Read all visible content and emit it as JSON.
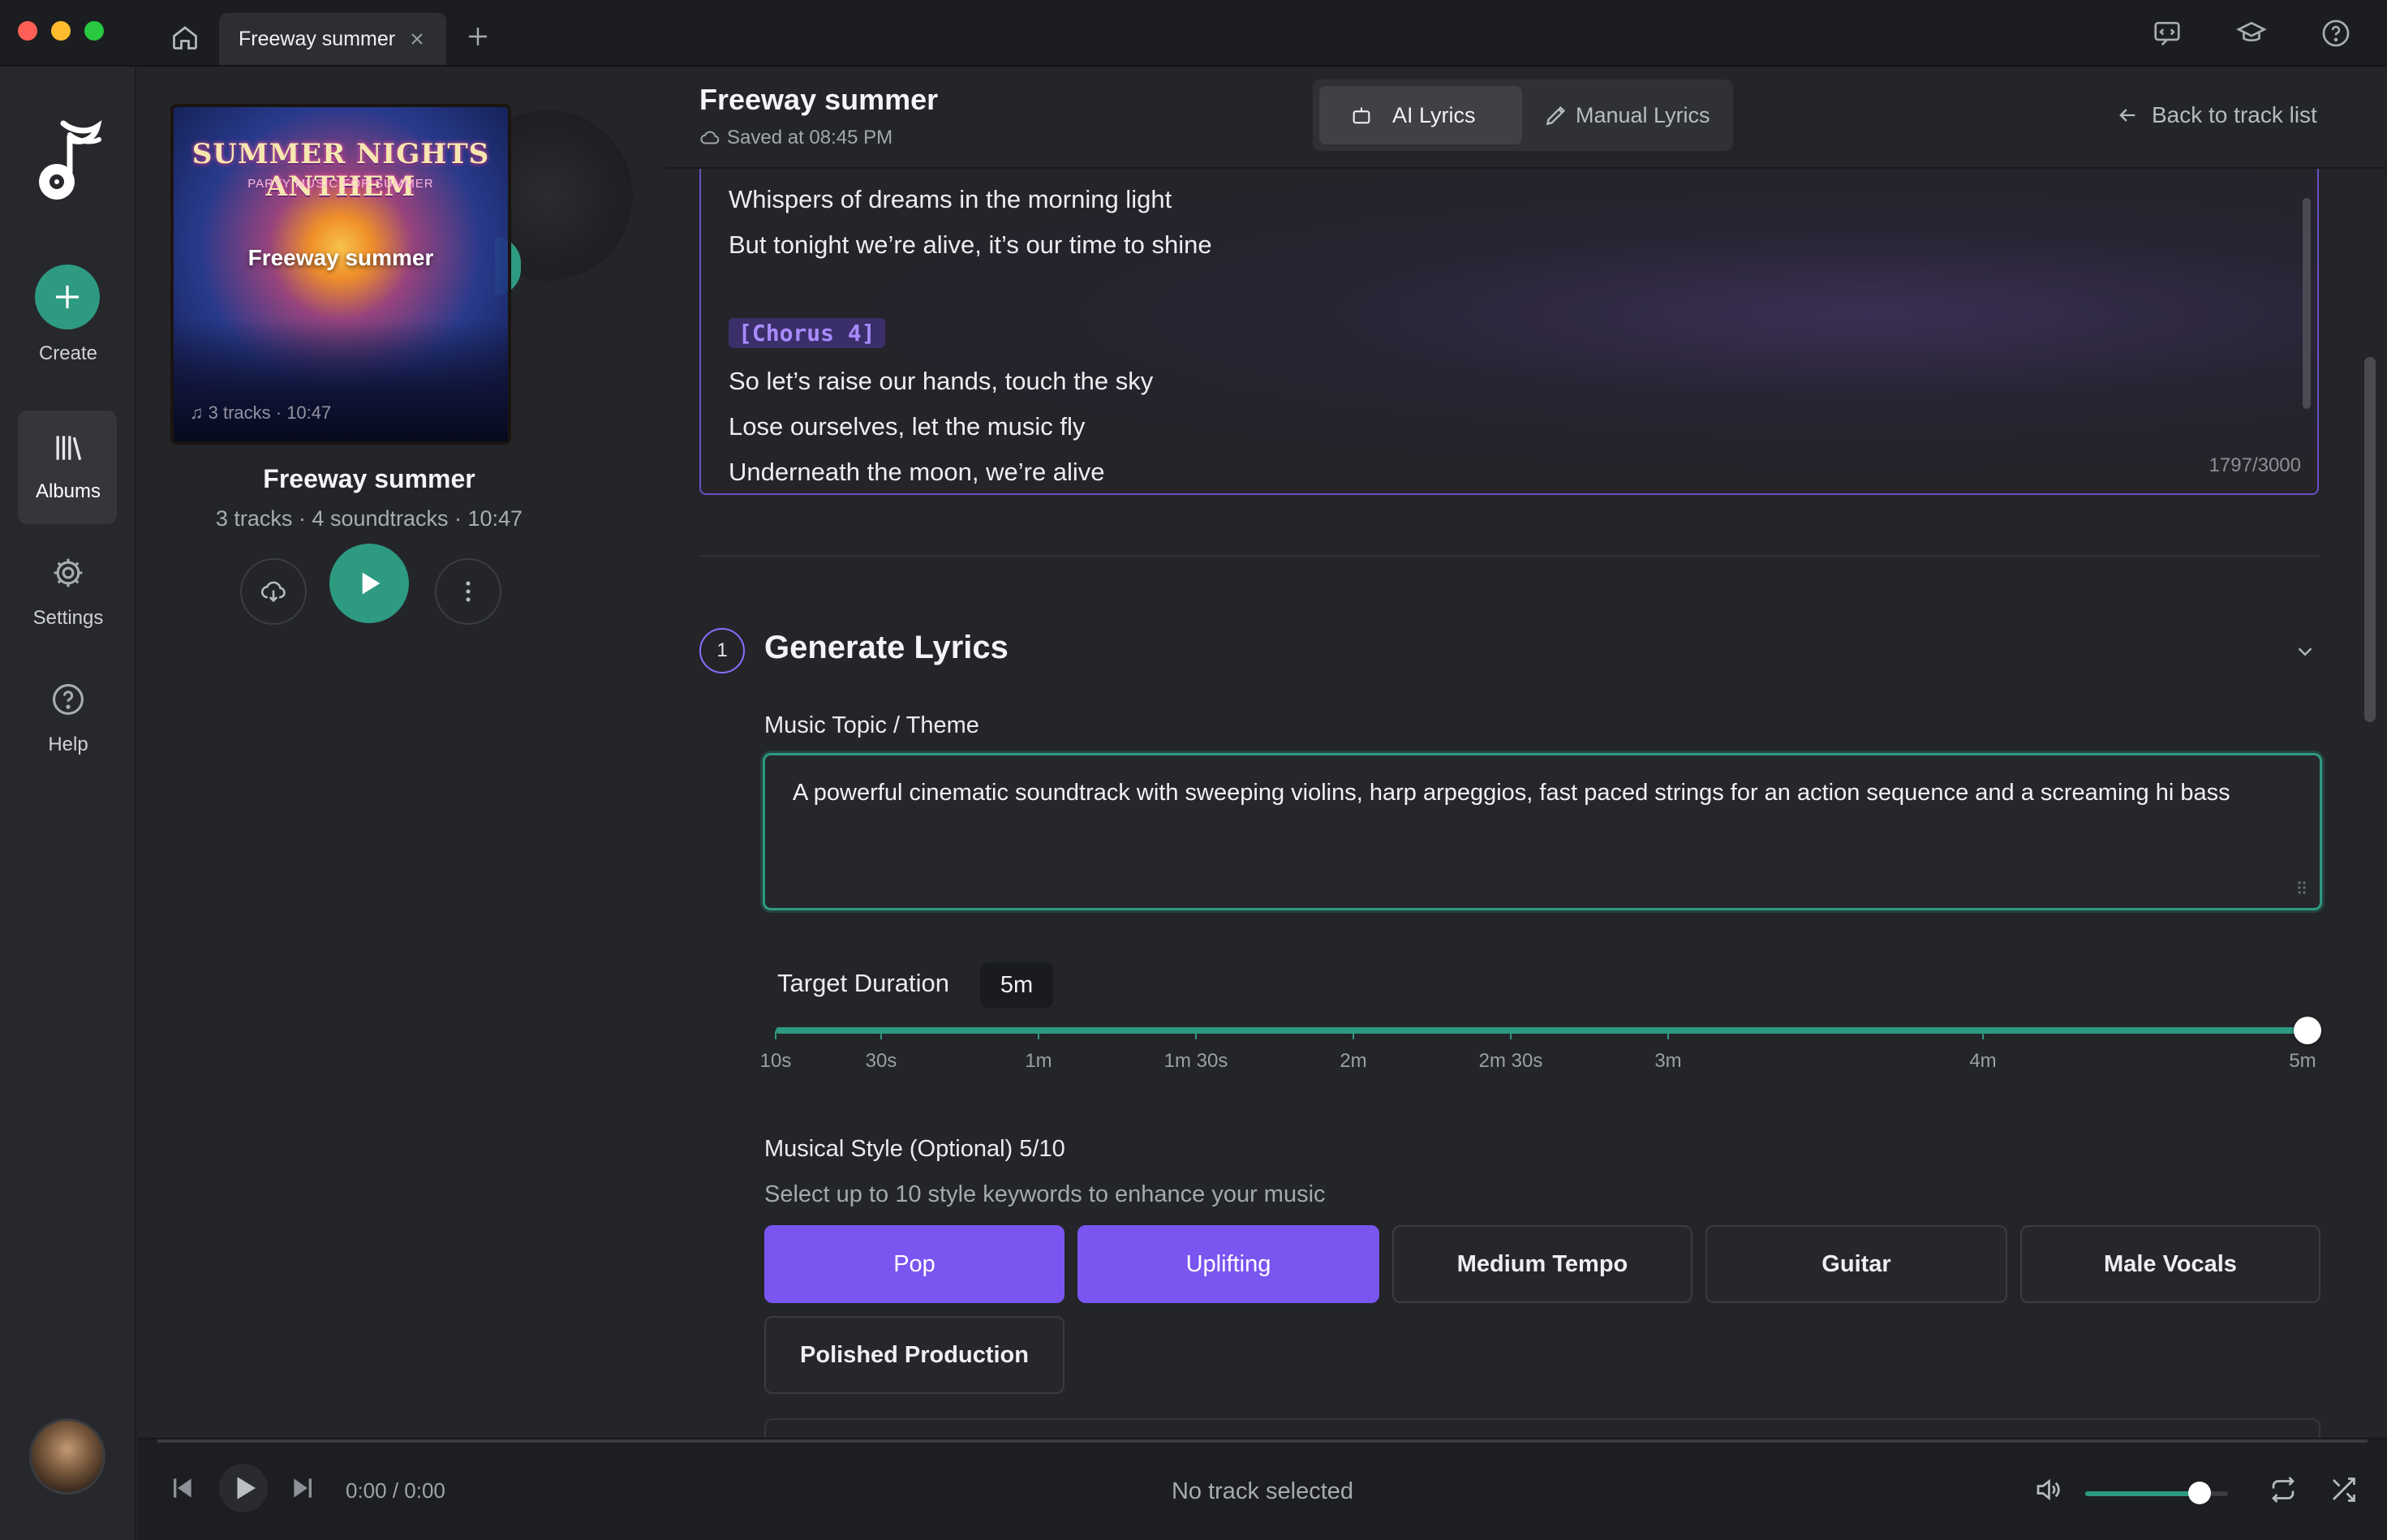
{
  "colors": {
    "accent_teal": "#2e9a82",
    "accent_purple": "#7a55f0",
    "background": "#232529"
  },
  "tab": {
    "label": "Freeway summer"
  },
  "rail": {
    "create_label": "Create",
    "albums_label": "Albums",
    "settings_label": "Settings",
    "help_label": "Help"
  },
  "album": {
    "cover_title": "SUMMER NIGHTS ANTHEM",
    "cover_subtitle": "PARTY MUSIC FOR SUMMER",
    "cover_overlay_title": "Freeway summer",
    "cover_overlay_meta": "3 tracks · 10:47",
    "name": "Freeway summer",
    "meta": "3 tracks · 4 soundtracks · 10:47"
  },
  "editor": {
    "title": "Freeway summer",
    "saved": "Saved at 08:45 PM",
    "mode_ai": "AI Lyrics",
    "mode_manual": "Manual Lyrics",
    "back": "Back to track list"
  },
  "lyrics": {
    "line1": "Whispers of dreams in the morning light",
    "line2": "But tonight we’re alive, it’s our time to shine",
    "tag": "[Chorus 4]",
    "line3": "So let’s raise our hands, touch the sky",
    "line4": "Lose ourselves, let the music fly",
    "line5": "Underneath the moon, we’re alive",
    "char_count": "1797/3000"
  },
  "generate": {
    "step": "1",
    "title": "Generate Lyrics",
    "topic_label": "Music Topic / Theme",
    "topic_value": "A powerful cinematic soundtrack with sweeping violins, harp arpeggios, fast paced strings for an action sequence and a screaming hi bass"
  },
  "duration": {
    "label": "Target Duration",
    "value_label": "5m",
    "value_fraction": 1.0,
    "ticks": [
      "10s",
      "30s",
      "1m",
      "1m 30s",
      "2m",
      "2m 30s",
      "3m",
      "4m",
      "5m"
    ]
  },
  "style": {
    "title": "Musical Style (Optional) 5/10",
    "subtitle": "Select up to 10 style keywords to enhance your music",
    "chips": [
      {
        "label": "Pop",
        "selected": true
      },
      {
        "label": "Uplifting",
        "selected": true
      },
      {
        "label": "Medium Tempo",
        "selected": false
      },
      {
        "label": "Guitar",
        "selected": false
      },
      {
        "label": "Male Vocals",
        "selected": false
      },
      {
        "label": "Polished Production",
        "selected": false
      }
    ]
  },
  "player": {
    "time": "0:00 / 0:00",
    "now_playing": "No track selected",
    "volume_fraction": 0.8
  }
}
